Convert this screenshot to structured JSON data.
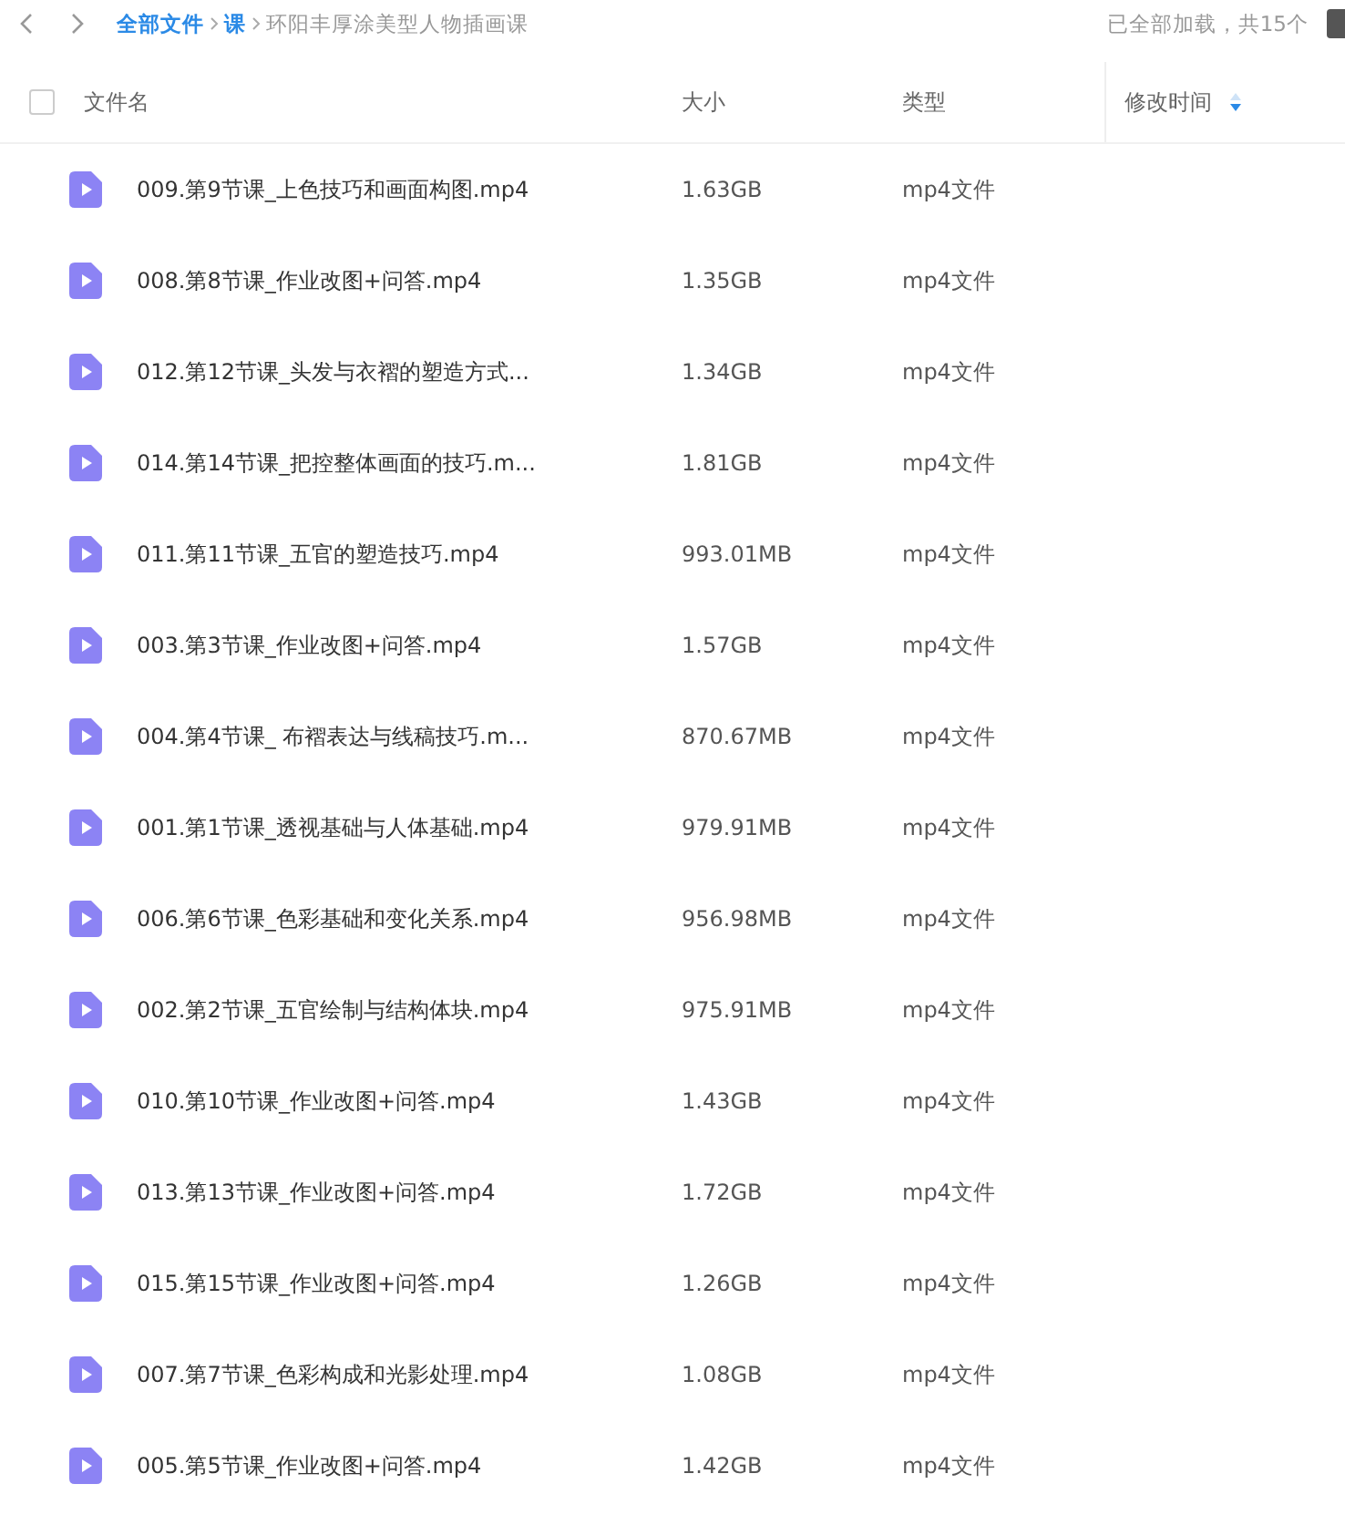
{
  "breadcrumb": [
    {
      "label": "全部文件",
      "current": false
    },
    {
      "label": "课",
      "current": false
    },
    {
      "label": "环阳丰厚涂美型人物插画课",
      "current": true
    }
  ],
  "load_status": "已全部加载，共15个",
  "select_all": {
    "checked": false
  },
  "columns": [
    {
      "label": "文件名",
      "sorted": false
    },
    {
      "label": "大小",
      "sorted": false
    },
    {
      "label": "类型",
      "sorted": false
    },
    {
      "label": "修改时间",
      "sorted": true
    }
  ],
  "rows": [
    {
      "name": "009.第9节课_上色技巧和画面构图.mp4",
      "size": "1.63GB",
      "type": "mp4文件"
    },
    {
      "name": "008.第8节课_作业改图+问答.mp4",
      "size": "1.35GB",
      "type": "mp4文件"
    },
    {
      "name": "012.第12节课_头发与衣褶的塑造方式...",
      "size": "1.34GB",
      "type": "mp4文件"
    },
    {
      "name": "014.第14节课_把控整体画面的技巧.m...",
      "size": "1.81GB",
      "type": "mp4文件"
    },
    {
      "name": "011.第11节课_五官的塑造技巧.mp4",
      "size": "993.01MB",
      "type": "mp4文件"
    },
    {
      "name": "003.第3节课_作业改图+问答.mp4",
      "size": "1.57GB",
      "type": "mp4文件"
    },
    {
      "name": "004.第4节课_ 布褶表达与线稿技巧.m...",
      "size": "870.67MB",
      "type": "mp4文件"
    },
    {
      "name": "001.第1节课_透视基础与人体基础.mp4",
      "size": "979.91MB",
      "type": "mp4文件"
    },
    {
      "name": "006.第6节课_色彩基础和变化关系.mp4",
      "size": "956.98MB",
      "type": "mp4文件"
    },
    {
      "name": "002.第2节课_五官绘制与结构体块.mp4",
      "size": "975.91MB",
      "type": "mp4文件"
    },
    {
      "name": "010.第10节课_作业改图+问答.mp4",
      "size": "1.43GB",
      "type": "mp4文件"
    },
    {
      "name": "013.第13节课_作业改图+问答.mp4",
      "size": "1.72GB",
      "type": "mp4文件"
    },
    {
      "name": "015.第15节课_作业改图+问答.mp4",
      "size": "1.26GB",
      "type": "mp4文件"
    },
    {
      "name": "007.第7节课_色彩构成和光影处理.mp4",
      "size": "1.08GB",
      "type": "mp4文件"
    },
    {
      "name": "005.第5节课_作业改图+问答.mp4",
      "size": "1.42GB",
      "type": "mp4文件"
    }
  ]
}
